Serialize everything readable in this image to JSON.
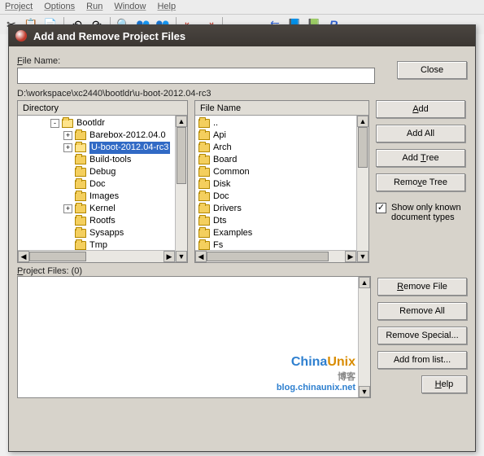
{
  "menubar": [
    "Project",
    "Options",
    "Run",
    "Window",
    "Help"
  ],
  "dialog": {
    "title": "Add and Remove Project Files",
    "file_name_label": "File Name:",
    "file_name_value": "",
    "path": "D:\\workspace\\xc2440\\bootldr\\u-boot-2012.04-rc3",
    "directory_header": "Directory",
    "file_name_header": "File Name",
    "project_files_label": "Project Files: (0)",
    "show_only_label": "Show only known document types",
    "show_only_checked": true
  },
  "buttons": {
    "close": "Close",
    "add": "Add",
    "add_all": "Add All",
    "add_tree": "Add Tree",
    "remove_tree": "Remove Tree",
    "remove_file": "Remove File",
    "remove_all": "Remove All",
    "remove_special": "Remove Special...",
    "add_from_list": "Add from list...",
    "help": "Help"
  },
  "dir_tree": [
    {
      "depth": 0,
      "exp": "-",
      "open": true,
      "label": "Bootldr"
    },
    {
      "depth": 1,
      "exp": "+",
      "open": false,
      "label": "Barebox-2012.04.0"
    },
    {
      "depth": 1,
      "exp": "+",
      "open": true,
      "label": "U-boot-2012.04-rc3",
      "selected": true
    },
    {
      "depth": 1,
      "exp": "",
      "open": false,
      "label": "Build-tools"
    },
    {
      "depth": 1,
      "exp": "",
      "open": false,
      "label": "Debug"
    },
    {
      "depth": 1,
      "exp": "",
      "open": false,
      "label": "Doc"
    },
    {
      "depth": 1,
      "exp": "",
      "open": false,
      "label": "Images"
    },
    {
      "depth": 1,
      "exp": "+",
      "open": false,
      "label": "Kernel"
    },
    {
      "depth": 1,
      "exp": "",
      "open": false,
      "label": "Rootfs"
    },
    {
      "depth": 1,
      "exp": "",
      "open": false,
      "label": "Sysapps"
    },
    {
      "depth": 1,
      "exp": "",
      "open": false,
      "label": "Tmp"
    }
  ],
  "file_list": [
    {
      "label": ".."
    },
    {
      "label": "Api"
    },
    {
      "label": "Arch"
    },
    {
      "label": "Board"
    },
    {
      "label": "Common"
    },
    {
      "label": "Disk"
    },
    {
      "label": "Doc"
    },
    {
      "label": "Drivers"
    },
    {
      "label": "Dts"
    },
    {
      "label": "Examples"
    },
    {
      "label": "Fs"
    }
  ],
  "watermark": {
    "brand_a": "China",
    "brand_b": "Unix",
    "brand_c": " 博客",
    "url": "blog.chinaunix.net"
  }
}
